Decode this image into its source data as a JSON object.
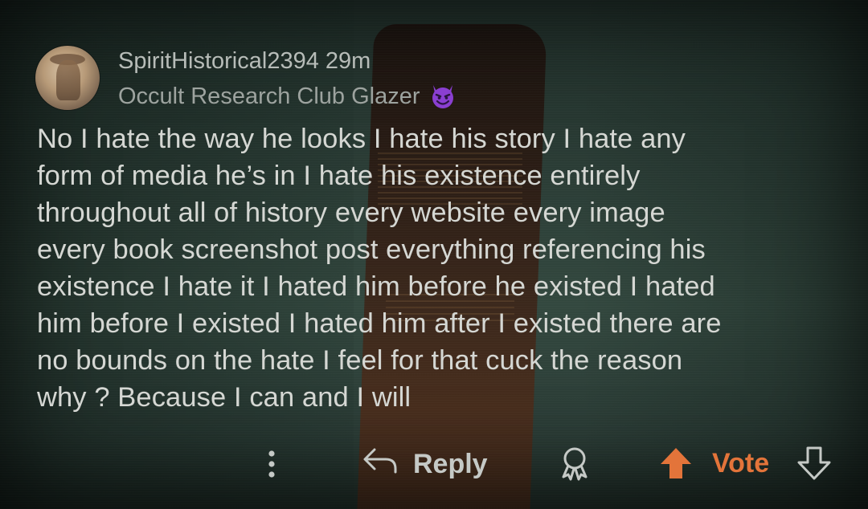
{
  "comment": {
    "username": "SpiritHistorical2394",
    "time": "29m",
    "flair": "Occult Research Club Glazer",
    "flair_emoji_icon": "smiling-devil-icon",
    "body": "No I hate the way he looks I hate his story I hate  any\nform of media he’s in I hate his existence entirely\nthroughout all of history every website every image\nevery book screenshot post  everything referencing his\nexistence I hate it I hated him before he existed I hated\nhim before I existed I hated him after I existed there are\nno bounds on the hate I feel for that cuck the reason\nwhy ? Because I can and I will"
  },
  "actions": {
    "more_icon": "vertical-dots-icon",
    "reply_icon": "reply-arrow-icon",
    "reply_label": "Reply",
    "award_icon": "award-icon",
    "upvote_icon": "upvote-arrow-icon",
    "vote_label": "Vote",
    "downvote_icon": "downvote-arrow-icon"
  },
  "colors": {
    "accent": "#e3743a",
    "text": "#d5d7d3",
    "muted": "#9da39f",
    "devil": "#8a3fd1"
  }
}
